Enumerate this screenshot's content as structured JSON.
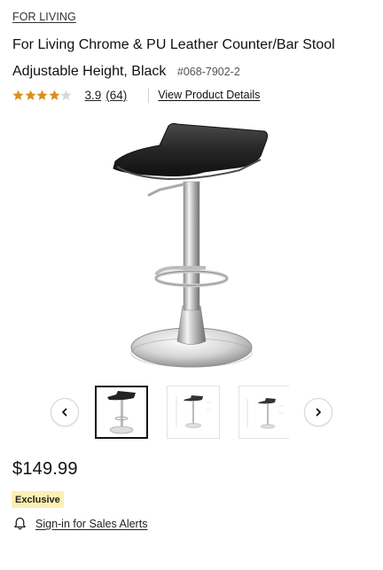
{
  "product": {
    "brand": "FOR LIVING",
    "title": "For Living  Chrome & PU Leather Counter/Bar Stool Adjustable Height, Black",
    "sku": "#068-7902-2",
    "rating": {
      "stars": 3.9,
      "value": "3.9",
      "count": "(64)",
      "star_color": "#d9901a",
      "empty_star_color": "#d8d8d8"
    },
    "view_details_label": "View Product Details",
    "price": "$149.99",
    "badge": "Exclusive",
    "badge_color": "#fdf0b3",
    "sales_alert_label": "Sign-in for Sales Alerts"
  },
  "gallery": {
    "main_image": "bar-stool-front-view",
    "thumbnails": [
      {
        "image": "bar-stool-front-view",
        "selected": true
      },
      {
        "image": "bar-stool-dimensions-view",
        "selected": false
      },
      {
        "image": "bar-stool-dimensions-side-view",
        "selected": false
      }
    ],
    "prev_icon": "chevron-left-icon",
    "next_icon": "chevron-right-icon"
  },
  "icons": {
    "bell": "bell-icon",
    "star": "star-icon"
  }
}
